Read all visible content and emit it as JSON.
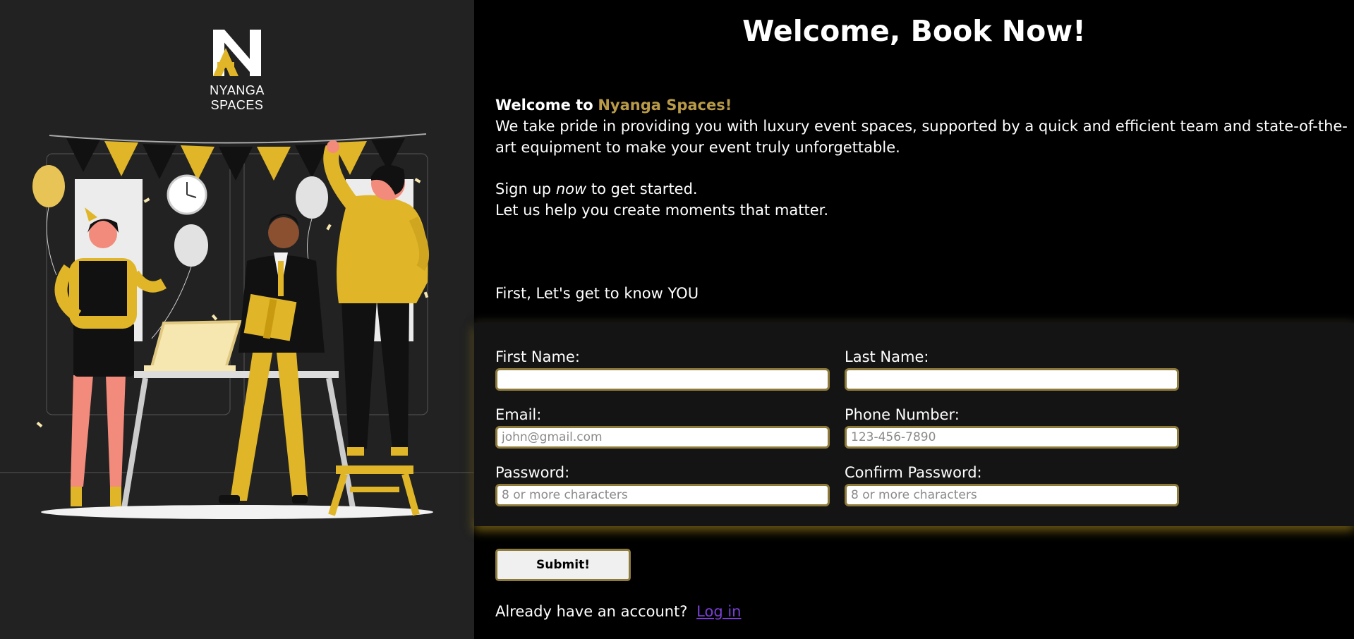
{
  "brand": {
    "name": "NYANGA SPACES",
    "accent_color": "#e0b628"
  },
  "hero": {
    "title": "Welcome, Book Now!",
    "welcome_prefix": "Welcome to",
    "welcome_brand": "Nyanga Spaces!",
    "about": "We take pride in providing you with luxury event spaces, supported by a quick and efficient team and state-of-the-art equipment to make your event truly unforgettable.",
    "signup_prefix": "Sign up",
    "signup_emphasis": "now",
    "signup_suffix": "to get started.",
    "moments": "Let us help you create moments that matter.",
    "get_to_know": "First, Let's get to know YOU"
  },
  "form": {
    "first_name": {
      "label": "First Name:",
      "value": "",
      "placeholder": ""
    },
    "last_name": {
      "label": "Last Name:",
      "value": "",
      "placeholder": ""
    },
    "email": {
      "label": "Email:",
      "value": "",
      "placeholder": "john@gmail.com"
    },
    "phone": {
      "label": "Phone Number:",
      "value": "",
      "placeholder": "123-456-7890"
    },
    "password": {
      "label": "Password:",
      "value": "",
      "placeholder": "8 or more characters"
    },
    "confirm_password": {
      "label": "Confirm Password:",
      "value": "",
      "placeholder": "8 or more characters"
    },
    "submit_label": "Submit!"
  },
  "login": {
    "prompt": "Already have an account?",
    "link_label": "Log in"
  },
  "illustration": {
    "icon": "party-illustration",
    "colors": {
      "yellow": "#e0b628",
      "black": "#111111",
      "skin": "#f28b7b"
    }
  }
}
